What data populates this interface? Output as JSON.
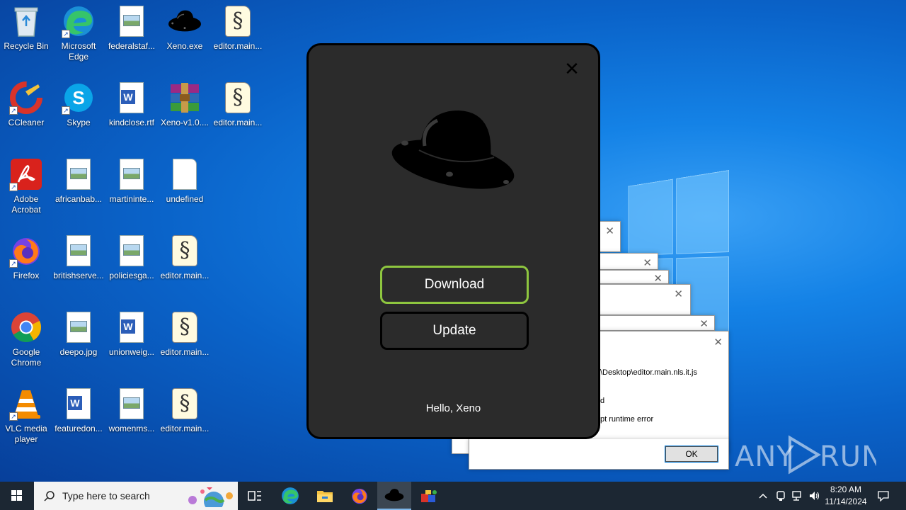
{
  "desktop": {
    "icons": [
      {
        "label": "Recycle Bin",
        "icon": "recycle-bin-icon"
      },
      {
        "label": "Microsoft Edge",
        "icon": "edge-icon"
      },
      {
        "label": "federalstaf...",
        "icon": "image-file-icon"
      },
      {
        "label": "Xeno.exe",
        "icon": "xeno-hat-icon"
      },
      {
        "label": "editor.main...",
        "icon": "script-file-icon"
      },
      {
        "label": "CCleaner",
        "icon": "ccleaner-icon"
      },
      {
        "label": "Skype",
        "icon": "skype-icon"
      },
      {
        "label": "kindclose.rtf",
        "icon": "word-doc-icon"
      },
      {
        "label": "Xeno-v1.0....",
        "icon": "winrar-icon"
      },
      {
        "label": "editor.main...",
        "icon": "script-file-icon"
      },
      {
        "label": "Adobe Acrobat",
        "icon": "acrobat-icon"
      },
      {
        "label": "africanbab...",
        "icon": "image-file-icon"
      },
      {
        "label": "martininte...",
        "icon": "image-file-icon"
      },
      {
        "label": "undefined",
        "icon": "blank-file-icon"
      },
      {
        "label": "Firefox",
        "icon": "firefox-icon"
      },
      {
        "label": "britishserve...",
        "icon": "image-file-icon"
      },
      {
        "label": "policiesga...",
        "icon": "image-file-icon"
      },
      {
        "label": "editor.main...",
        "icon": "script-file-icon"
      },
      {
        "label": "Google Chrome",
        "icon": "chrome-icon"
      },
      {
        "label": "deepo.jpg",
        "icon": "image-file-icon"
      },
      {
        "label": "unionweig...",
        "icon": "word-doc-icon"
      },
      {
        "label": "editor.main...",
        "icon": "script-file-icon"
      },
      {
        "label": "VLC media player",
        "icon": "vlc-icon"
      },
      {
        "label": "featuredon...",
        "icon": "word-doc-icon"
      },
      {
        "label": "womenms...",
        "icon": "image-file-icon"
      },
      {
        "label": "editor.main...",
        "icon": "script-file-icon"
      }
    ]
  },
  "error_dialog": {
    "path_fragment": "\\Desktop\\editor.main.nls.it.js",
    "line2": "d",
    "line3": "pt runtime error",
    "ok_label": "OK"
  },
  "xeno_dialog": {
    "close_symbol": "✕",
    "download_label": "Download",
    "update_label": "Update",
    "greeting": "Hello, Xeno",
    "accent_color": "#8ec63f"
  },
  "watermark": {
    "text": "ANY RUN"
  },
  "taskbar": {
    "search_placeholder": "Type here to search",
    "clock_time": "8:20 AM",
    "clock_date": "11/14/2024"
  }
}
